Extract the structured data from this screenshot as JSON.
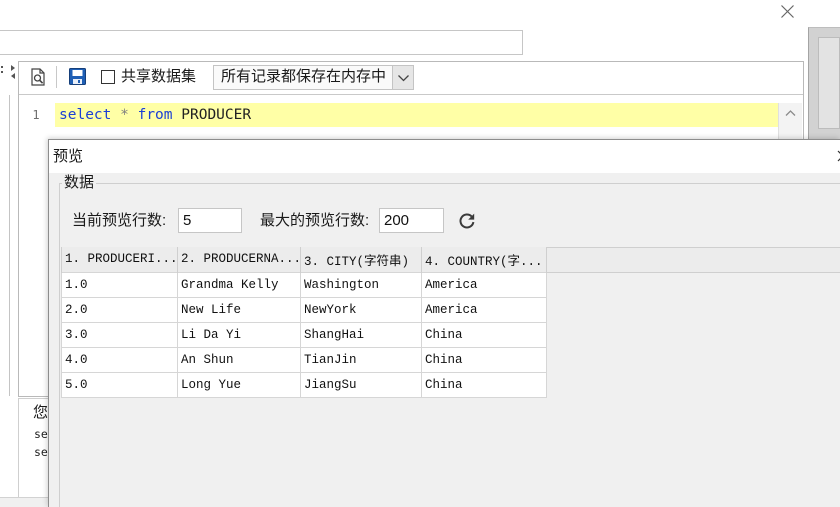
{
  "toolbar": {
    "share_dataset_label": "共享数据集",
    "share_dataset_checked": false,
    "record_mode_selected": "所有记录都保存在内存中"
  },
  "editor": {
    "line_numbers": [
      "1"
    ],
    "tokens": [
      {
        "text": "select",
        "kind": "keyword"
      },
      {
        "text": "*",
        "kind": "operator"
      },
      {
        "text": "from",
        "kind": "keyword"
      },
      {
        "text": "PRODUCER",
        "kind": "identifier"
      }
    ]
  },
  "messages": {
    "lines": [
      "您",
      "se",
      "se"
    ]
  },
  "preview": {
    "title": "预览",
    "group_label": "数据",
    "current_rows_label": "当前预览行数:",
    "current_rows_value": "5",
    "max_rows_label": "最大的预览行数:",
    "max_rows_value": "200",
    "table": {
      "columns": [
        "1. PRODUCERI...",
        "2. PRODUCERNA...",
        "3. CITY(字符串)",
        "4. COUNTRY(字..."
      ],
      "rows": [
        [
          "1.0",
          "Grandma Kelly",
          "Washington",
          "America"
        ],
        [
          "2.0",
          "New Life",
          "NewYork",
          "America"
        ],
        [
          "3.0",
          "Li Da Yi",
          "ShangHai",
          "China"
        ],
        [
          "4.0",
          "An Shun",
          "TianJin",
          "China"
        ],
        [
          "5.0",
          "Long Yue",
          "JiangSu",
          "China"
        ]
      ]
    }
  },
  "icons": {
    "dialog_close": "close-icon",
    "side_panel_handle": "collapse-handle-icon",
    "preview_document": "document-preview-icon",
    "save": "save-icon",
    "dropdown": "chevron-down-icon",
    "scroll_up": "chevron-up-icon",
    "refresh": "refresh-icon",
    "preview_close": "close-icon"
  },
  "colors": {
    "sql_keyword": "#1b3fd6",
    "sql_operator": "#808080",
    "current_line_highlight": "#ffffa6",
    "save_icon_blue": "#1f5fb5",
    "dialog_body": "#f0f0f0"
  }
}
